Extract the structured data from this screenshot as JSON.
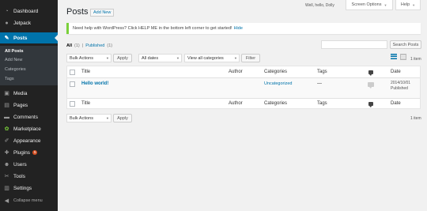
{
  "admin_menu": {
    "items": [
      {
        "label": "Dashboard",
        "icon": "dashboard-icon",
        "glyph": "◔"
      },
      {
        "label": "Jetpack",
        "icon": "jetpack-icon",
        "glyph": "●"
      },
      {
        "label": "Posts",
        "icon": "pin-icon",
        "glyph": "✎"
      },
      {
        "label": "Media",
        "icon": "media-icon",
        "glyph": "▣"
      },
      {
        "label": "Pages",
        "icon": "pages-icon",
        "glyph": "▤"
      },
      {
        "label": "Comments",
        "icon": "comments-icon",
        "glyph": "▬"
      },
      {
        "label": "Marketplace",
        "icon": "marketplace-icon",
        "glyph": "✿"
      },
      {
        "label": "Appearance",
        "icon": "brush-icon",
        "glyph": "✐"
      },
      {
        "label": "Plugins",
        "icon": "plugin-icon",
        "glyph": "✚",
        "badge": "5"
      },
      {
        "label": "Users",
        "icon": "users-icon",
        "glyph": "☻"
      },
      {
        "label": "Tools",
        "icon": "tools-icon",
        "glyph": "✂"
      },
      {
        "label": "Settings",
        "icon": "settings-icon",
        "glyph": "▥"
      },
      {
        "label": "Collapse menu",
        "icon": "collapse-icon",
        "glyph": "◀"
      }
    ],
    "posts_submenu": [
      "All Posts",
      "Add New",
      "Categories",
      "Tags"
    ]
  },
  "header": {
    "title": "Posts",
    "add_new": "Add New",
    "howdy": "Well, hello, Dolly",
    "screen_options": "Screen Options",
    "help": "Help"
  },
  "notice": {
    "text": "Need help with WordPress? Click HELP ME in the bottom left corner to get started!",
    "hide": "Hide"
  },
  "views": {
    "all": "All",
    "all_count": "(1)",
    "sep": "|",
    "published": "Published",
    "published_count": "(1)"
  },
  "search": {
    "button": "Search Posts",
    "value": ""
  },
  "filters": {
    "bulk_actions": "Bulk Actions",
    "apply": "Apply",
    "dates": "All dates",
    "categories": "View all categories",
    "filter": "Filter",
    "items_count": "1 item"
  },
  "table": {
    "columns": {
      "title": "Title",
      "author": "Author",
      "categories": "Categories",
      "tags": "Tags",
      "date": "Date"
    },
    "rows": [
      {
        "title": "Hello world!",
        "author": "",
        "categories": "Uncategorized",
        "tags": "—",
        "date": "2014/10/01",
        "status": "Published"
      }
    ]
  }
}
